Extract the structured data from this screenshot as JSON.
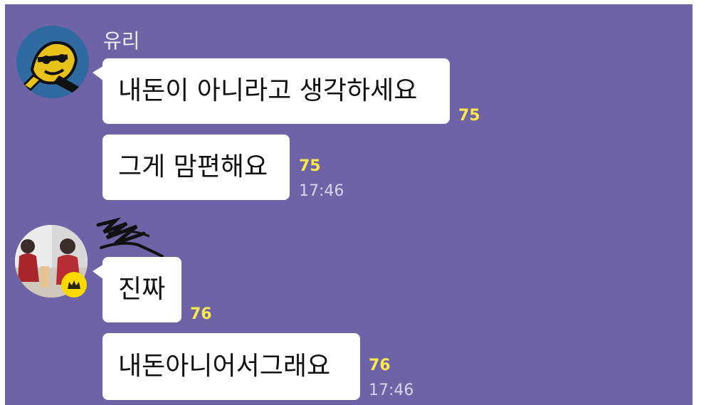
{
  "messages": [
    {
      "sender": "유리",
      "items": [
        {
          "text": "내돈이 아니라고 생각하세요",
          "unread": "75"
        },
        {
          "text": "그게 맘편해요",
          "unread": "75",
          "time": "17:46"
        }
      ]
    },
    {
      "sender_redacted": true,
      "items": [
        {
          "text": "진짜",
          "unread": "76"
        },
        {
          "text": "내돈아니어서그래요",
          "unread": "76",
          "time": "17:46"
        }
      ]
    }
  ],
  "colors": {
    "background": "#6e63a6",
    "bubble": "#ffffff",
    "unread": "#ffe84a",
    "crown_badge": "#ffd800"
  },
  "icons": [
    "avatar-character",
    "avatar-photo",
    "crown-icon"
  ]
}
